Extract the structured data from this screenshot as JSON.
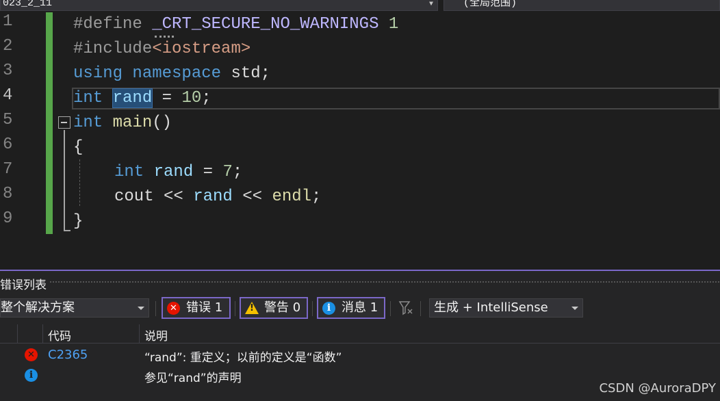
{
  "topbar": {
    "project_combo": "023_2_11",
    "scope_combo": "(全局范围)"
  },
  "editor": {
    "line_numbers": [
      "1",
      "2",
      "3",
      "4",
      "5",
      "6",
      "7",
      "8",
      "9"
    ],
    "lines": {
      "l1": {
        "directive": "#define",
        "macro": "_CRT_SECURE_NO_WARNINGS",
        "value": "1"
      },
      "l2": {
        "directive": "#include",
        "header": "<iostream>"
      },
      "l3": {
        "kw1": "using",
        "kw2": "namespace",
        "rest": "std;"
      },
      "l4": {
        "kw": "int",
        "selected": "rand",
        "rest1": " = ",
        "num": "10",
        "rest2": ";"
      },
      "l5": {
        "kw": "int",
        "fn": "main",
        "rest": "()"
      },
      "l6": {
        "brace": "{"
      },
      "l7": {
        "kw": "int",
        "var": "rand",
        "rest1": " = ",
        "num": "7",
        "rest2": ";"
      },
      "l8": {
        "var1": "cout",
        "op1": " << ",
        "var2": "rand",
        "op2": " << ",
        "fn": "endl",
        "rest": ";"
      },
      "l9": {
        "brace": "}"
      }
    }
  },
  "error_list": {
    "title": "错误列表",
    "scope_dropdown": "整个解决方案",
    "errors_label": "错误 1",
    "warnings_label": "警告 0",
    "messages_label": "消息 1",
    "build_dropdown": "生成 + IntelliSense",
    "columns": {
      "code": "代码",
      "description": "说明"
    },
    "rows": [
      {
        "type": "error",
        "code": "C2365",
        "description": "“rand”: 重定义；以前的定义是“函数”"
      },
      {
        "type": "info",
        "code": "",
        "description": "参见“rand”的声明"
      }
    ]
  },
  "watermark": "CSDN @AuroraDPY",
  "colors": {
    "accent": "#7b68c8",
    "change_bar": "#57a64a",
    "error": "#e51400",
    "info": "#1a8fe3",
    "warning": "#f5c000"
  }
}
